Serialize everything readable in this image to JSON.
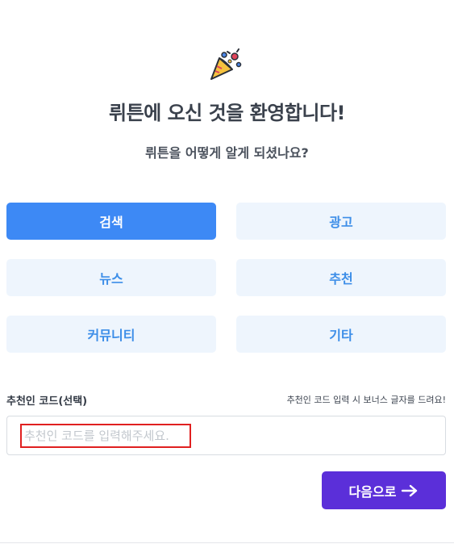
{
  "header": {
    "icon": "party-popper-icon",
    "title": "뤼튼에 오신 것을 환영합니다!",
    "subtitle": "뤼튼을 어떻게 알게 되셨나요?"
  },
  "options": [
    {
      "label": "검색",
      "selected": true
    },
    {
      "label": "광고",
      "selected": false
    },
    {
      "label": "뉴스",
      "selected": false
    },
    {
      "label": "추천",
      "selected": false
    },
    {
      "label": "커뮤니티",
      "selected": false
    },
    {
      "label": "기타",
      "selected": false
    }
  ],
  "referral": {
    "label": "추천인 코드(선택)",
    "hint": "추천인 코드 입력 시 보너스 글자를 드려요!",
    "value": "",
    "placeholder": "추천인 코드를 입력해주세요."
  },
  "next_button": {
    "label": "다음으로",
    "icon": "arrow-right-icon"
  },
  "colors": {
    "selected_bg": "#3d89f5",
    "option_bg": "#eef5fd",
    "option_text": "#3d8ee8",
    "primary_button": "#5b2fd9",
    "highlight_border": "#e02020"
  }
}
